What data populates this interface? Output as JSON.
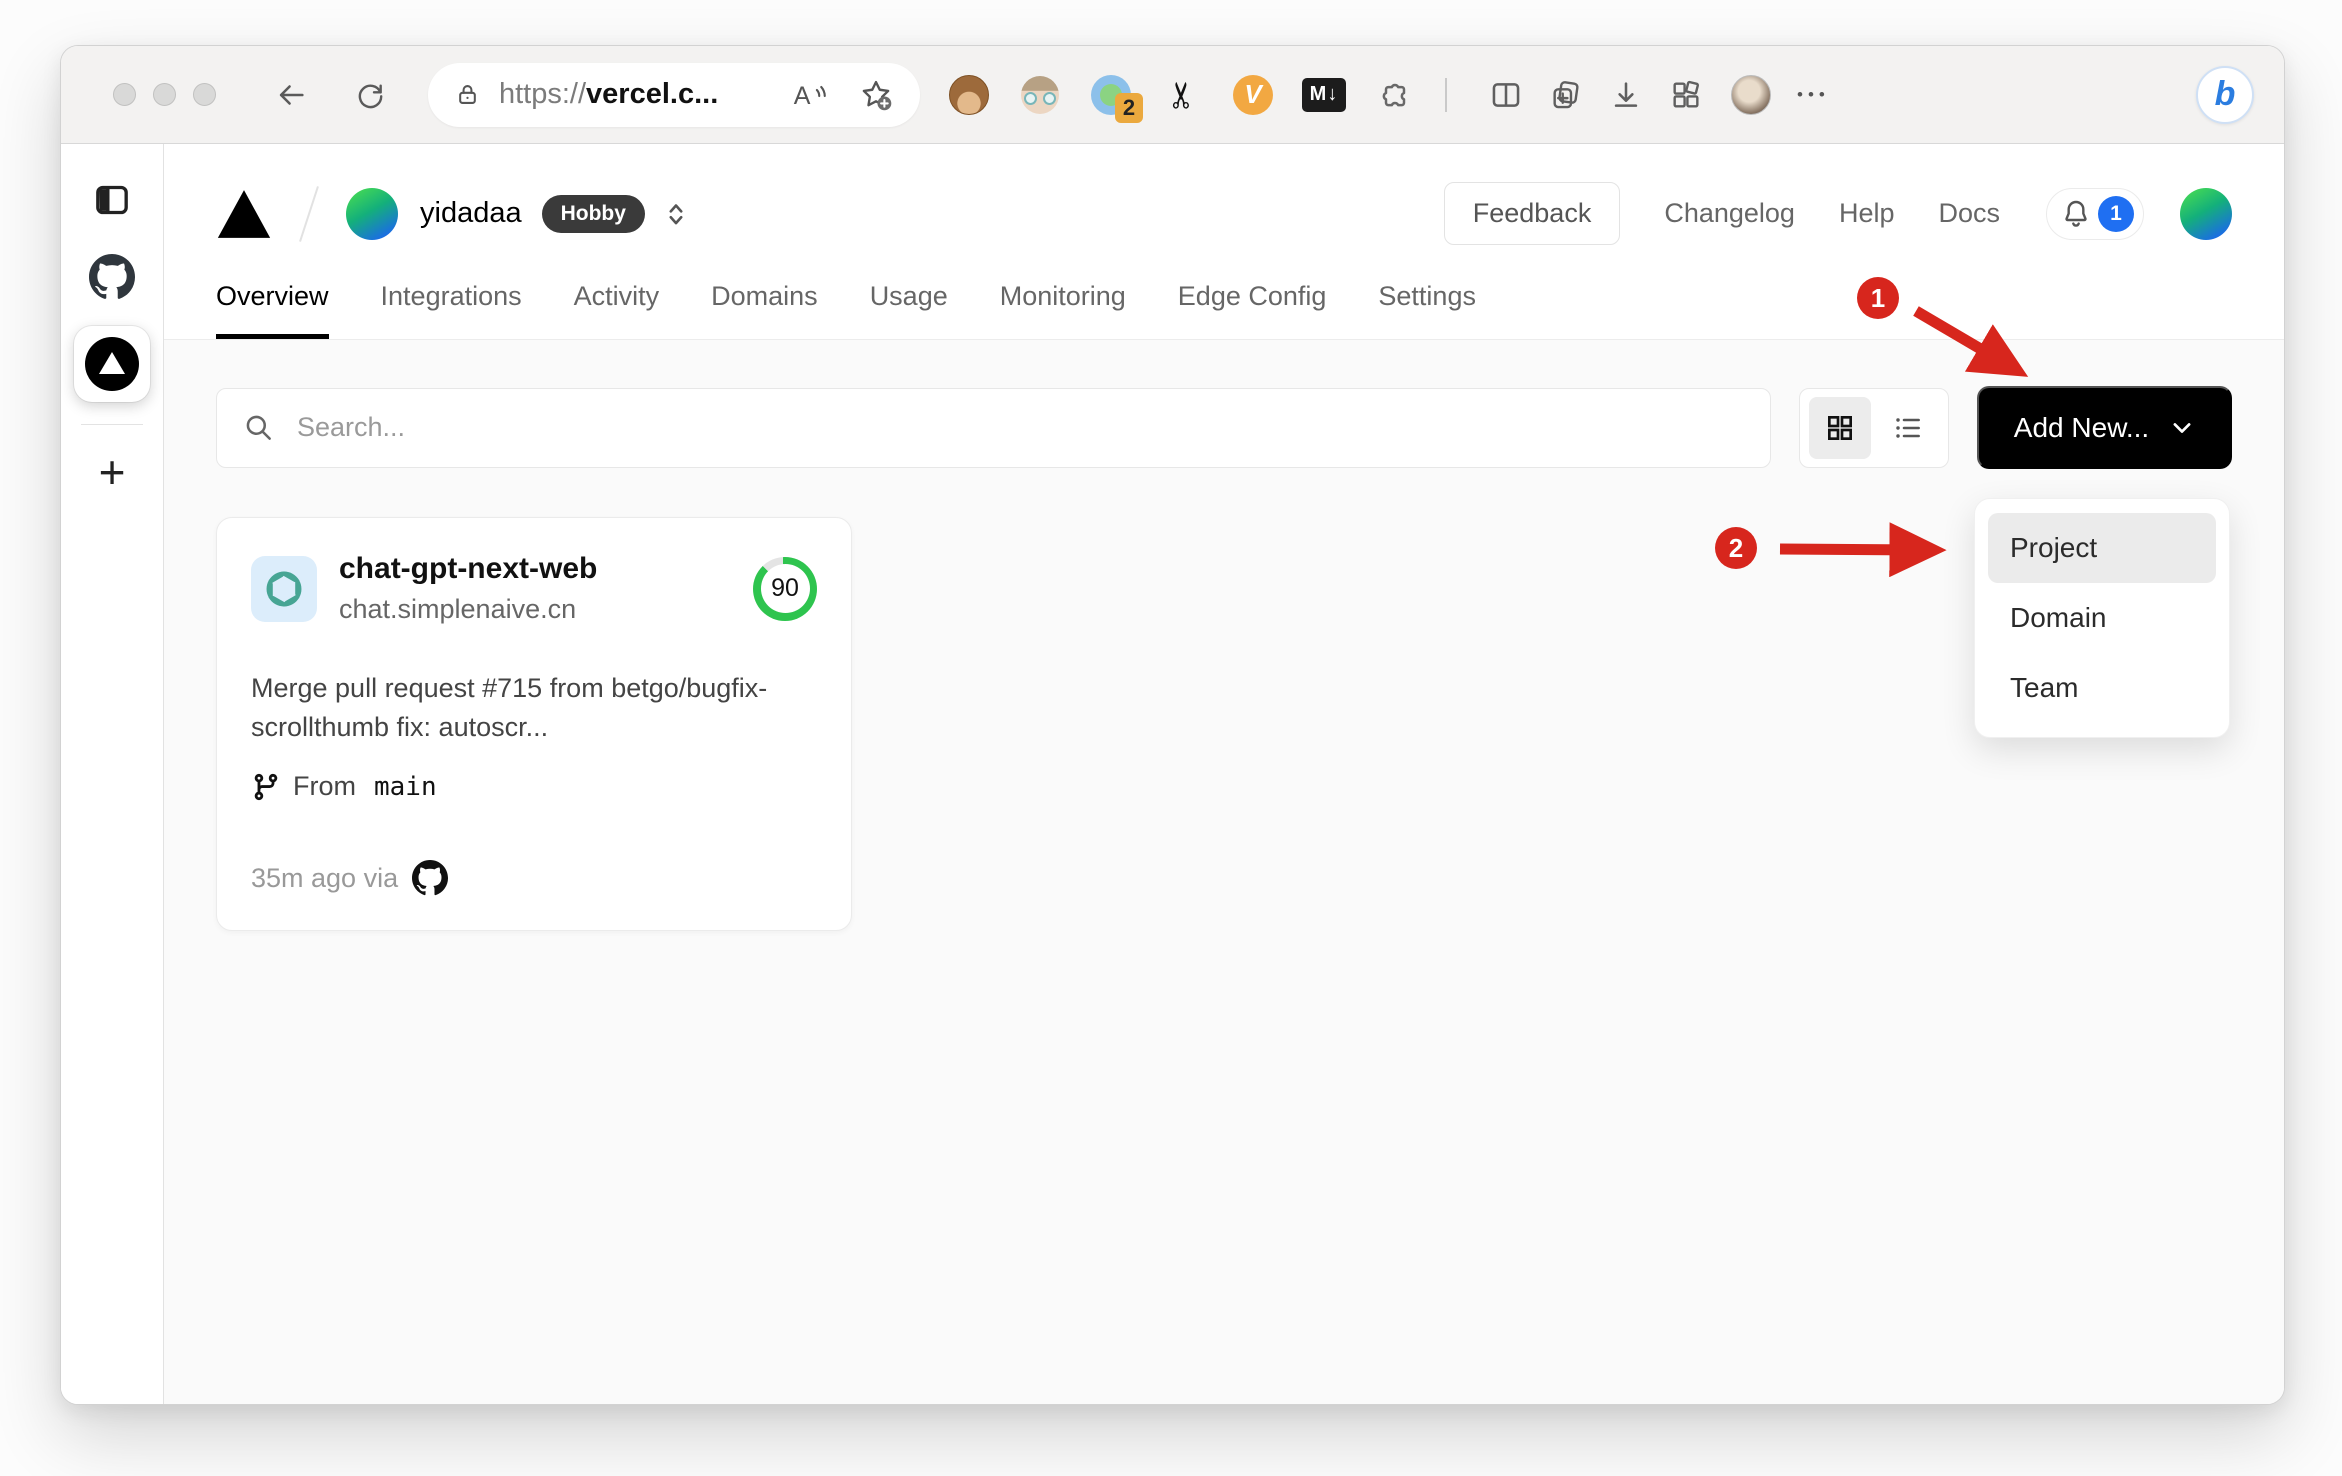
{
  "browser": {
    "url": {
      "scheme": "https://",
      "host": "vercel.c..."
    },
    "extensions": {
      "proxy_badge": "2",
      "scissors_glyph": "✂",
      "vimium_label": "V",
      "markdown_label": "M↓"
    },
    "more_label": "•••",
    "bing_label": "b"
  },
  "sidebar": {
    "plus_glyph": "+"
  },
  "header": {
    "team_name": "yidadaa",
    "plan_badge": "Hobby",
    "feedback_label": "Feedback",
    "links": [
      {
        "label": "Changelog"
      },
      {
        "label": "Help"
      },
      {
        "label": "Docs"
      }
    ],
    "notification_count": "1"
  },
  "tabs": {
    "items": [
      {
        "label": "Overview"
      },
      {
        "label": "Integrations"
      },
      {
        "label": "Activity"
      },
      {
        "label": "Domains"
      },
      {
        "label": "Usage"
      },
      {
        "label": "Monitoring"
      },
      {
        "label": "Edge Config"
      },
      {
        "label": "Settings"
      }
    ]
  },
  "controls": {
    "search_placeholder": "Search...",
    "add_new_label": "Add New..."
  },
  "dropdown": {
    "items": [
      {
        "label": "Project"
      },
      {
        "label": "Domain"
      },
      {
        "label": "Team"
      }
    ]
  },
  "project_card": {
    "name": "chat-gpt-next-web",
    "domain": "chat.simplenaive.cn",
    "score": "90",
    "commit_message": "Merge pull request #715 from betgo/bugfix-scrollthumb fix: autoscr...",
    "branch_prefix": "From",
    "branch_name": "main",
    "deployed_text": "35m ago via"
  },
  "annotations": {
    "step1": "1",
    "step2": "2"
  }
}
